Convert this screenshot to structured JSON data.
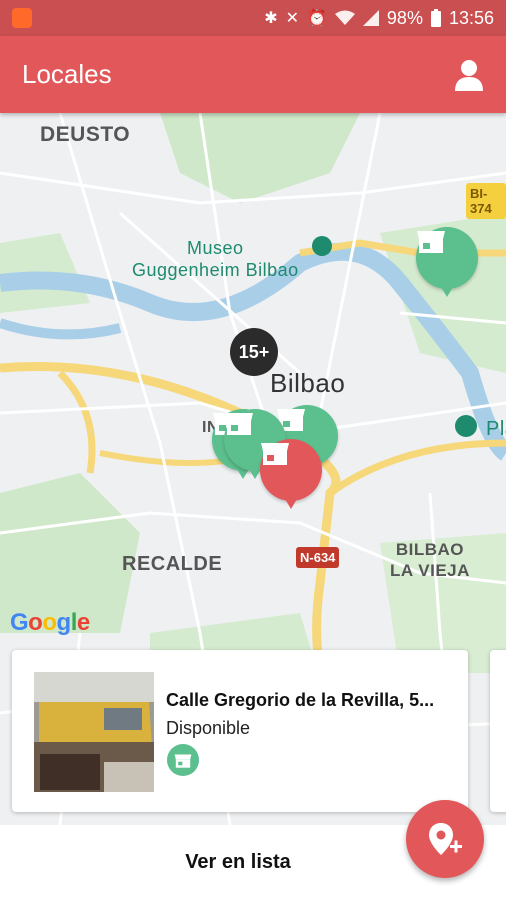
{
  "status_bar": {
    "icons": [
      "app-notification-icon",
      "bluetooth-icon",
      "mute-icon",
      "alarm-icon",
      "wifi-icon",
      "signal-icon",
      "battery-icon"
    ],
    "battery": "98%",
    "time": "13:56"
  },
  "app_bar": {
    "title": "Locales",
    "profile_icon": "person-icon"
  },
  "map": {
    "labels": {
      "deusto": "DEUSTO",
      "museo": "Museo\nGuggenheim Bilbao",
      "bilbao": "Bilbao",
      "recalde": "RECALDE",
      "bilbao_vieja": "BILBAO\nLA VIEJA",
      "pl": "Pla",
      "in": "IN"
    },
    "road_badges": [
      "BI-374",
      "N-634"
    ],
    "cluster_count": "15+",
    "markers": [
      {
        "type": "store",
        "color": "#5cbf8e"
      },
      {
        "type": "store",
        "color": "#5cbf8e"
      },
      {
        "type": "store",
        "color": "#5cbf8e"
      },
      {
        "type": "store",
        "color": "#5cbf8e"
      },
      {
        "type": "store-selected",
        "color": "#e2585a"
      }
    ],
    "attribution": [
      "G",
      "o",
      "o",
      "g",
      "l",
      "e"
    ]
  },
  "card": {
    "address": "Calle Gregorio de la Revilla, 5...",
    "status": "Disponible",
    "type_icon": "store-icon"
  },
  "bottom": {
    "list_label": "Ver en lista",
    "fab_icon": "add-location-icon"
  },
  "colors": {
    "primary": "#e2585a",
    "status_bar": "#c94f50",
    "marker_green": "#5cbf8e"
  }
}
